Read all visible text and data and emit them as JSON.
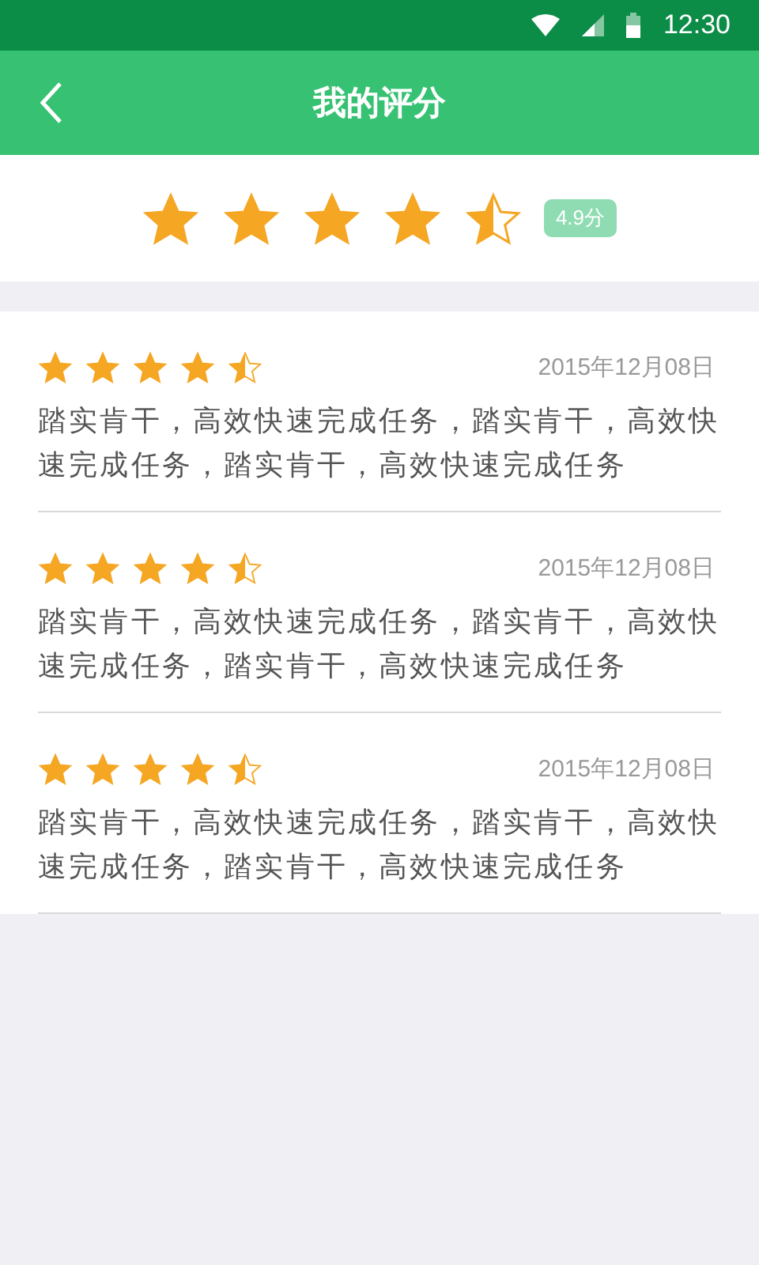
{
  "status_bar": {
    "time": "12:30"
  },
  "header": {
    "title": "我的评分"
  },
  "summary": {
    "stars": 4.5,
    "score": "4.9分"
  },
  "reviews": [
    {
      "stars": 4.5,
      "date": "2015年12月08日",
      "text": "踏实肯干，高效快速完成任务，踏实肯干，高效快速完成任务，踏实肯干，高效快速完成任务"
    },
    {
      "stars": 4.5,
      "date": "2015年12月08日",
      "text": "踏实肯干，高效快速完成任务，踏实肯干，高效快速完成任务，踏实肯干，高效快速完成任务"
    },
    {
      "stars": 4.5,
      "date": "2015年12月08日",
      "text": "踏实肯干，高效快速完成任务，踏实肯干，高效快速完成任务，踏实肯干，高效快速完成任务"
    }
  ]
}
